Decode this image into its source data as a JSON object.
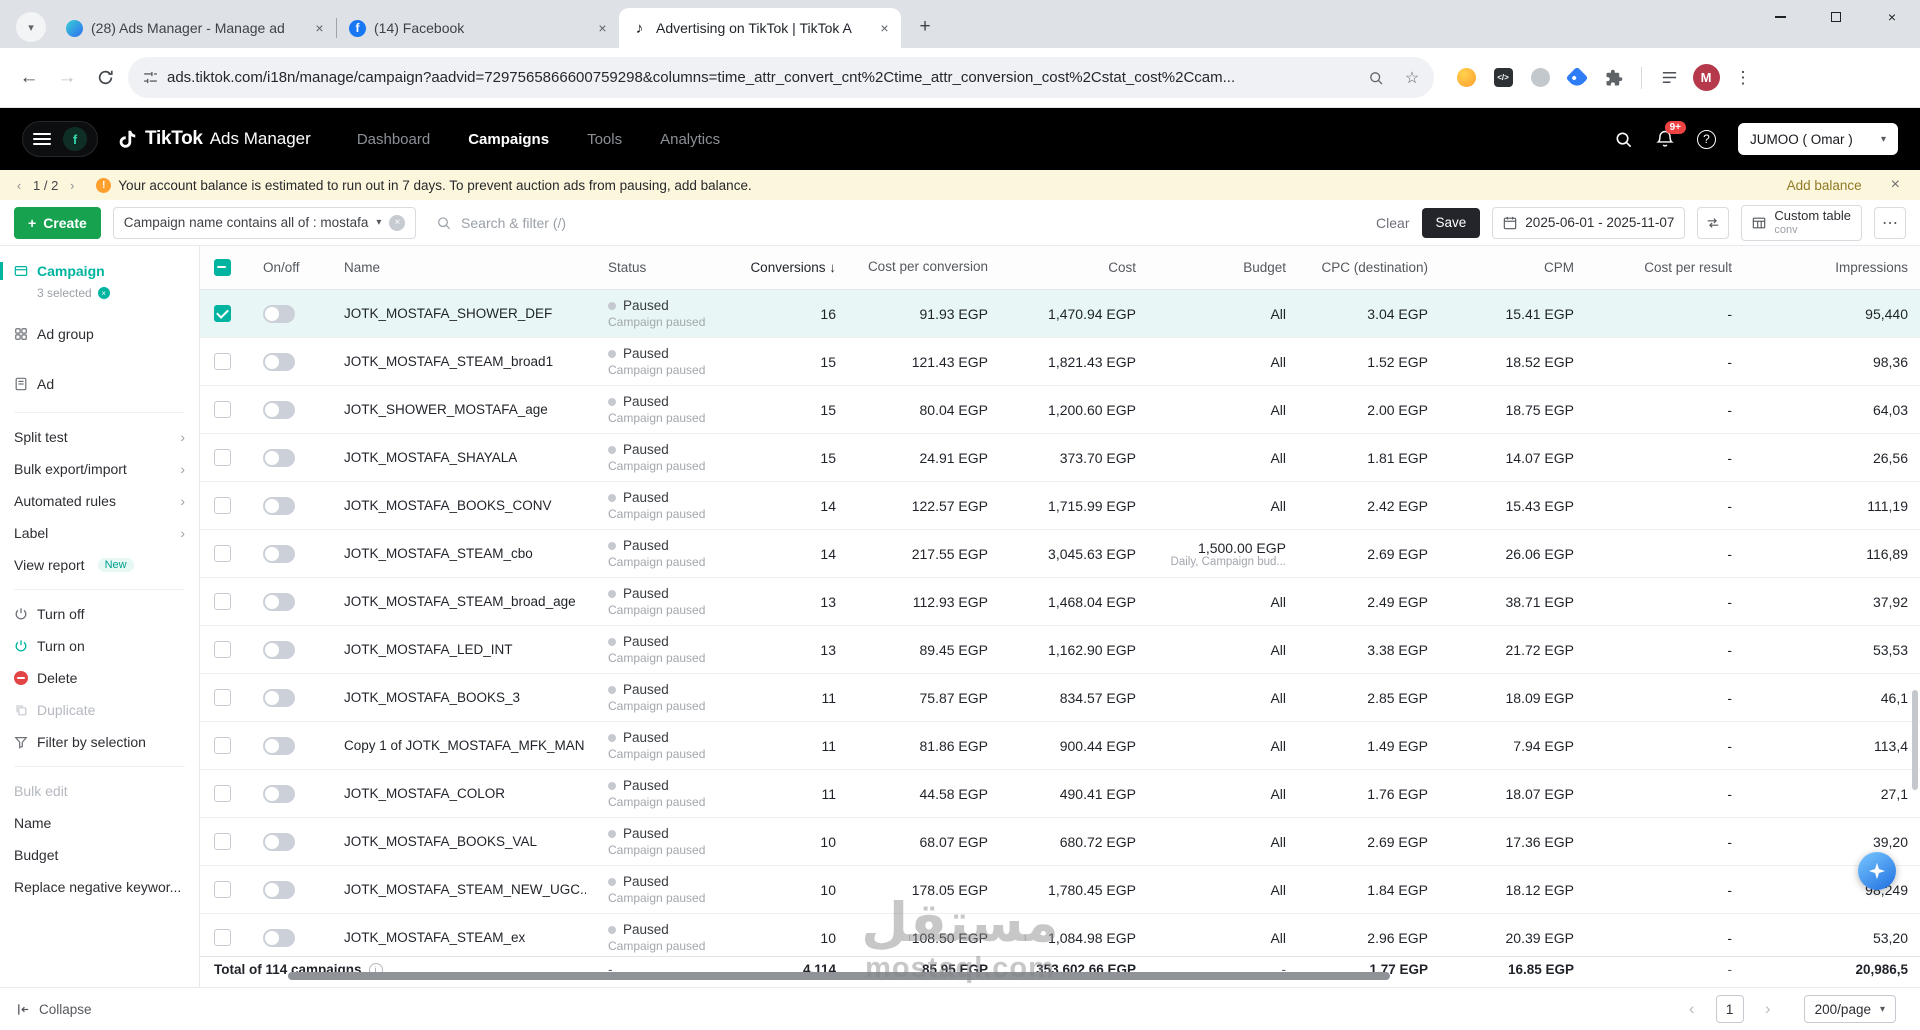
{
  "browser": {
    "tabs": [
      {
        "title": "(28) Ads Manager - Manage ad"
      },
      {
        "title": "(14) Facebook"
      },
      {
        "title": "Advertising on TikTok | TikTok A"
      }
    ],
    "url": "ads.tiktok.com/i18n/manage/campaign?aadvid=7297565866600759298&columns=time_attr_convert_cnt%2Ctime_attr_conversion_cost%2Cstat_cost%2Ccam..."
  },
  "header": {
    "brand_primary": "TikTok",
    "brand_secondary": "Ads Manager",
    "nav": [
      "Dashboard",
      "Campaigns",
      "Tools",
      "Analytics"
    ],
    "notification_badge": "9+",
    "workspace_initial": "f",
    "account_name": "JUMOO ( Omar )"
  },
  "banner": {
    "position": "1 / 2",
    "message": "Your account balance is estimated to run out in 7 days. To prevent auction ads from pausing, add balance.",
    "action": "Add balance"
  },
  "toolbar": {
    "create": "Create",
    "filter_chip": "Campaign name contains all of : mostafa",
    "search_placeholder": "Search & filter (/)",
    "clear": "Clear",
    "save": "Save",
    "date_range": "2025-06-01 - 2025-11-07",
    "custom_table": "Custom table",
    "custom_table_sub": "conv"
  },
  "sidebar": {
    "campaign": "Campaign",
    "campaign_sub": "3 selected",
    "ad_group": "Ad group",
    "ad": "Ad",
    "split_test": "Split test",
    "bulk_export": "Bulk export/import",
    "automated_rules": "Automated rules",
    "label": "Label",
    "view_report": "View report",
    "new_badge": "New",
    "turn_off": "Turn off",
    "turn_on": "Turn on",
    "delete": "Delete",
    "duplicate": "Duplicate",
    "filter_by_selection": "Filter by selection",
    "bulk_edit": "Bulk edit",
    "name": "Name",
    "budget": "Budget",
    "replace_negative": "Replace negative keywor...",
    "collapse": "Collapse"
  },
  "table": {
    "columns": {
      "onoff": "On/off",
      "name": "Name",
      "status": "Status",
      "conversions": "Conversions",
      "cost_per_conversion": "Cost per conversion",
      "cost": "Cost",
      "budget": "Budget",
      "cpc": "CPC (destination)",
      "cpm": "CPM",
      "cost_per_result": "Cost per result",
      "impressions": "Impressions"
    },
    "rows": [
      {
        "checked": true,
        "selected": true,
        "name": "JOTK_MOSTAFA_SHOWER_DEF",
        "status": "Paused",
        "status_sub": "Campaign paused",
        "conversions": "16",
        "cost_per_conversion": "91.93 EGP",
        "cost": "1,470.94 EGP",
        "budget": "All",
        "budget_sub": "",
        "cpc": "3.04 EGP",
        "cpm": "15.41 EGP",
        "cost_per_result": "-",
        "impressions": "95,440"
      },
      {
        "name": "JOTK_MOSTAFA_STEAM_broad1",
        "status": "Paused",
        "status_sub": "Campaign paused",
        "conversions": "15",
        "cost_per_conversion": "121.43 EGP",
        "cost": "1,821.43 EGP",
        "budget": "All",
        "budget_sub": "",
        "cpc": "1.52 EGP",
        "cpm": "18.52 EGP",
        "cost_per_result": "-",
        "impressions": "98,36"
      },
      {
        "name": "JOTK_SHOWER_MOSTAFA_age",
        "status": "Paused",
        "status_sub": "Campaign paused",
        "conversions": "15",
        "cost_per_conversion": "80.04 EGP",
        "cost": "1,200.60 EGP",
        "budget": "All",
        "budget_sub": "",
        "cpc": "2.00 EGP",
        "cpm": "18.75 EGP",
        "cost_per_result": "-",
        "impressions": "64,03"
      },
      {
        "name": "JOTK_MOSTAFA_SHAYALA",
        "status": "Paused",
        "status_sub": "Campaign paused",
        "conversions": "15",
        "cost_per_conversion": "24.91 EGP",
        "cost": "373.70 EGP",
        "budget": "All",
        "budget_sub": "",
        "cpc": "1.81 EGP",
        "cpm": "14.07 EGP",
        "cost_per_result": "-",
        "impressions": "26,56"
      },
      {
        "name": "JOTK_MOSTAFA_BOOKS_CONV",
        "status": "Paused",
        "status_sub": "Campaign paused",
        "conversions": "14",
        "cost_per_conversion": "122.57 EGP",
        "cost": "1,715.99 EGP",
        "budget": "All",
        "budget_sub": "",
        "cpc": "2.42 EGP",
        "cpm": "15.43 EGP",
        "cost_per_result": "-",
        "impressions": "111,19"
      },
      {
        "name": "JOTK_MOSTAFA_STEAM_cbo",
        "status": "Paused",
        "status_sub": "Campaign paused",
        "conversions": "14",
        "cost_per_conversion": "217.55 EGP",
        "cost": "3,045.63 EGP",
        "budget": "1,500.00 EGP",
        "budget_sub": "Daily, Campaign bud...",
        "cpc": "2.69 EGP",
        "cpm": "26.06 EGP",
        "cost_per_result": "-",
        "impressions": "116,89"
      },
      {
        "name": "JOTK_MOSTAFA_STEAM_broad_age",
        "status": "Paused",
        "status_sub": "Campaign paused",
        "conversions": "13",
        "cost_per_conversion": "112.93 EGP",
        "cost": "1,468.04 EGP",
        "budget": "All",
        "budget_sub": "",
        "cpc": "2.49 EGP",
        "cpm": "38.71 EGP",
        "cost_per_result": "-",
        "impressions": "37,92"
      },
      {
        "name": "JOTK_MOSTAFA_LED_INT",
        "status": "Paused",
        "status_sub": "Campaign paused",
        "conversions": "13",
        "cost_per_conversion": "89.45 EGP",
        "cost": "1,162.90 EGP",
        "budget": "All",
        "budget_sub": "",
        "cpc": "3.38 EGP",
        "cpm": "21.72 EGP",
        "cost_per_result": "-",
        "impressions": "53,53"
      },
      {
        "name": "JOTK_MOSTAFA_BOOKS_3",
        "status": "Paused",
        "status_sub": "Campaign paused",
        "conversions": "11",
        "cost_per_conversion": "75.87 EGP",
        "cost": "834.57 EGP",
        "budget": "All",
        "budget_sub": "",
        "cpc": "2.85 EGP",
        "cpm": "18.09 EGP",
        "cost_per_result": "-",
        "impressions": "46,1"
      },
      {
        "name": "Copy 1 of JOTK_MOSTAFA_MFK_MAN",
        "status": "Paused",
        "status_sub": "Campaign paused",
        "conversions": "11",
        "cost_per_conversion": "81.86 EGP",
        "cost": "900.44 EGP",
        "budget": "All",
        "budget_sub": "",
        "cpc": "1.49 EGP",
        "cpm": "7.94 EGP",
        "cost_per_result": "-",
        "impressions": "113,4"
      },
      {
        "name": "JOTK_MOSTAFA_COLOR",
        "status": "Paused",
        "status_sub": "Campaign paused",
        "conversions": "11",
        "cost_per_conversion": "44.58 EGP",
        "cost": "490.41 EGP",
        "budget": "All",
        "budget_sub": "",
        "cpc": "1.76 EGP",
        "cpm": "18.07 EGP",
        "cost_per_result": "-",
        "impressions": "27,1"
      },
      {
        "name": "JOTK_MOSTAFA_BOOKS_VAL",
        "status": "Paused",
        "status_sub": "Campaign paused",
        "conversions": "10",
        "cost_per_conversion": "68.07 EGP",
        "cost": "680.72 EGP",
        "budget": "All",
        "budget_sub": "",
        "cpc": "2.69 EGP",
        "cpm": "17.36 EGP",
        "cost_per_result": "-",
        "impressions": "39,20"
      },
      {
        "name": "JOTK_MOSTAFA_STEAM_NEW_UGC...",
        "status": "Paused",
        "status_sub": "Campaign paused",
        "conversions": "10",
        "cost_per_conversion": "178.05 EGP",
        "cost": "1,780.45 EGP",
        "budget": "All",
        "budget_sub": "",
        "cpc": "1.84 EGP",
        "cpm": "18.12 EGP",
        "cost_per_result": "-",
        "impressions": "98,249"
      },
      {
        "name": "JOTK_MOSTAFA_STEAM_ex",
        "status": "Paused",
        "status_sub": "Campaign paused",
        "conversions": "10",
        "cost_per_conversion": "108.50 EGP",
        "cost": "1,084.98 EGP",
        "budget": "All",
        "budget_sub": "",
        "cpc": "2.96 EGP",
        "cpm": "20.39 EGP",
        "cost_per_result": "-",
        "impressions": "53,20"
      }
    ],
    "total": {
      "label": "Total of 114 campaigns",
      "status": "-",
      "conversions": "4,114",
      "cost_per_conversion": "85.95 EGP",
      "cost": "353,602.66 EGP",
      "budget": "-",
      "cpc": "1.77 EGP",
      "cpm": "16.85 EGP",
      "cost_per_result": "-",
      "impressions": "20,986,5"
    }
  },
  "pagination": {
    "page": "1",
    "per_page": "200/page"
  },
  "watermark": {
    "arabic": "مستقل",
    "latin": "mostaql.com"
  },
  "colors": {
    "accent_teal": "#00b49f",
    "create_green": "#17a24f",
    "danger_red": "#e24545"
  }
}
